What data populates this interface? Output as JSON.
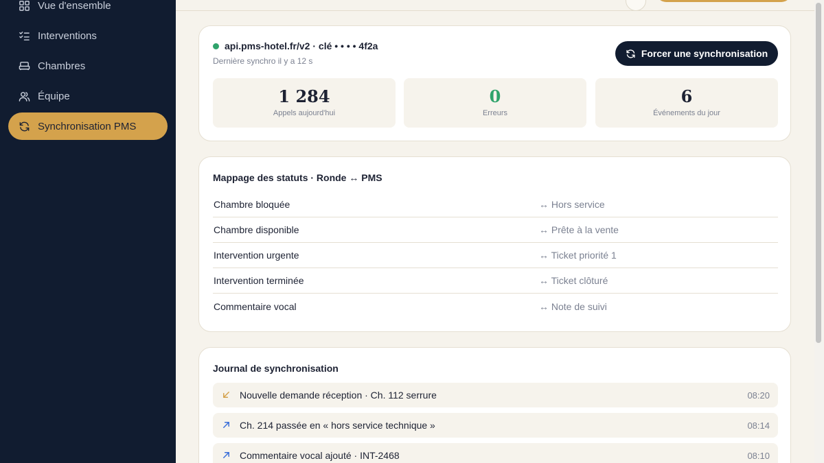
{
  "sidebar": {
    "items": [
      {
        "label": "Vue d'ensemble",
        "icon": "grid-icon"
      },
      {
        "label": "Interventions",
        "icon": "checklist-icon"
      },
      {
        "label": "Chambres",
        "icon": "bed-icon"
      },
      {
        "label": "Équipe",
        "icon": "users-icon"
      },
      {
        "label": "Synchronisation PMS",
        "icon": "refresh-icon",
        "active": true
      }
    ]
  },
  "connection": {
    "endpoint": "api.pms-hotel.fr/v2 · clé • • • • 4f2a",
    "status_color": "#2fa36b",
    "last_sync": "Dernière synchro il y a 12 s",
    "sync_button": "Forcer une synchronisation"
  },
  "stats": [
    {
      "value": "1 284",
      "label": "Appels aujourd'hui"
    },
    {
      "value": "0",
      "label": "Erreurs"
    },
    {
      "value": "6",
      "label": "Événements du jour"
    }
  ],
  "mapping": {
    "title": "Mappage des statuts · Ronde ↔ PMS",
    "rows": [
      {
        "ronde": "Chambre bloquée",
        "pms": "↔ Hors service"
      },
      {
        "ronde": "Chambre disponible",
        "pms": "↔ Prête à la vente"
      },
      {
        "ronde": "Intervention urgente",
        "pms": "↔ Ticket priorité 1"
      },
      {
        "ronde": "Intervention terminée",
        "pms": "↔ Ticket clôturé"
      },
      {
        "ronde": "Commentaire vocal",
        "pms": "↔ Note de suivi"
      }
    ]
  },
  "log": {
    "title": "Journal de synchronisation",
    "entries": [
      {
        "direction": "incoming",
        "icon": "arrow-down-left-icon",
        "text": "Nouvelle demande réception · Ch. 112 serrure",
        "time": "08:20"
      },
      {
        "direction": "outgoing",
        "icon": "arrow-up-right-icon",
        "text": "Ch. 214 passée en « hors service technique »",
        "time": "08:14"
      },
      {
        "direction": "outgoing",
        "icon": "arrow-up-right-icon",
        "text": "Commentaire vocal ajouté · INT-2468",
        "time": "08:10"
      }
    ]
  },
  "colors": {
    "sidebar_bg": "#111c30",
    "accent": "#d4a24c",
    "success": "#2fa36b",
    "incoming_arrow": "#d4a24c",
    "outgoing_arrow": "#3b6fd9"
  }
}
